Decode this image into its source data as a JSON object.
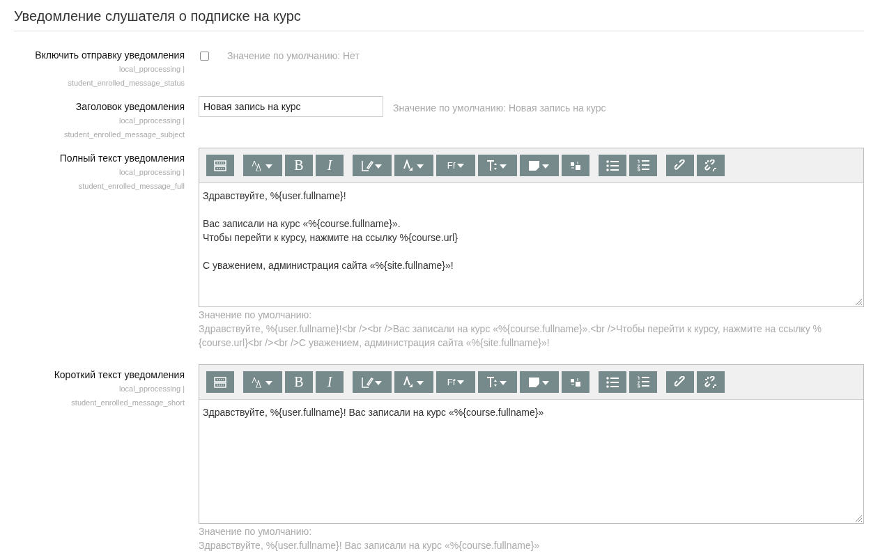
{
  "heading": "Уведомление слушателя о подписке на курс",
  "settings": [
    {
      "kind": "checkbox",
      "label": "Включить отправку уведомления",
      "plugin": "local_pprocessing |",
      "setting": "student_enrolled_message_status",
      "checked": false,
      "default_text": "Значение по умолчанию: Нет"
    },
    {
      "kind": "text",
      "label": "Заголовок уведомления",
      "plugin": "local_pprocessing |",
      "setting": "student_enrolled_message_subject",
      "value": "Новая запись на курс",
      "default_text": "Значение по умолчанию: Новая запись на курс"
    },
    {
      "kind": "editor",
      "label": "Полный текст уведомления",
      "plugin": "local_pprocessing |",
      "setting": "student_enrolled_message_full",
      "toolbar": [
        [
          {
            "kind": "html"
          }
        ],
        [
          {
            "kind": "style"
          },
          {
            "kind": "bold",
            "label": "B"
          },
          {
            "kind": "italic",
            "label": "I"
          }
        ],
        [
          {
            "kind": "pen"
          },
          {
            "kind": "fontcolor"
          },
          {
            "kind": "font",
            "label": "Ff"
          },
          {
            "kind": "size"
          },
          {
            "kind": "highlight"
          },
          {
            "kind": "special"
          }
        ],
        [
          {
            "kind": "ul"
          },
          {
            "kind": "ol"
          }
        ],
        [
          {
            "kind": "link"
          },
          {
            "kind": "unlink"
          }
        ]
      ],
      "paragraphs": [
        [
          "Здравствуйте, %{user.fullname}!"
        ],
        [
          "Вас записали на курс «%{course.fullname}».",
          "Чтобы перейти к курсу, нажмите на ссылку %{course.url}"
        ],
        [
          "С уважением, администрация сайта «%{site.fullname}»!"
        ]
      ],
      "default_label": "Значение по умолчанию:",
      "default_text": "Здравствуйте, %{user.fullname}!<br /><br />Вас записали на курс «%{course.fullname}».<br />Чтобы перейти к курсу, нажмите на ссылку %{course.url}<br /><br />С уважением, администрация сайта «%{site.fullname}»!"
    },
    {
      "kind": "editor",
      "label": "Короткий текст уведомления",
      "plugin": "local_pprocessing |",
      "setting": "student_enrolled_message_short",
      "toolbar": [
        [
          {
            "kind": "html"
          }
        ],
        [
          {
            "kind": "style"
          },
          {
            "kind": "bold",
            "label": "B"
          },
          {
            "kind": "italic",
            "label": "I"
          }
        ],
        [
          {
            "kind": "pen"
          },
          {
            "kind": "fontcolor"
          },
          {
            "kind": "font",
            "label": "Ff"
          },
          {
            "kind": "size"
          },
          {
            "kind": "highlight"
          },
          {
            "kind": "special"
          }
        ],
        [
          {
            "kind": "ul"
          },
          {
            "kind": "ol"
          }
        ],
        [
          {
            "kind": "link"
          },
          {
            "kind": "unlink"
          }
        ]
      ],
      "paragraphs": [
        [
          "Здравствуйте, %{user.fullname}! Вас записали на курс «%{course.fullname}»"
        ]
      ],
      "default_label": "Значение по умолчанию:",
      "default_text": "Здравствуйте, %{user.fullname}! Вас записали на курс «%{course.fullname}»"
    }
  ]
}
